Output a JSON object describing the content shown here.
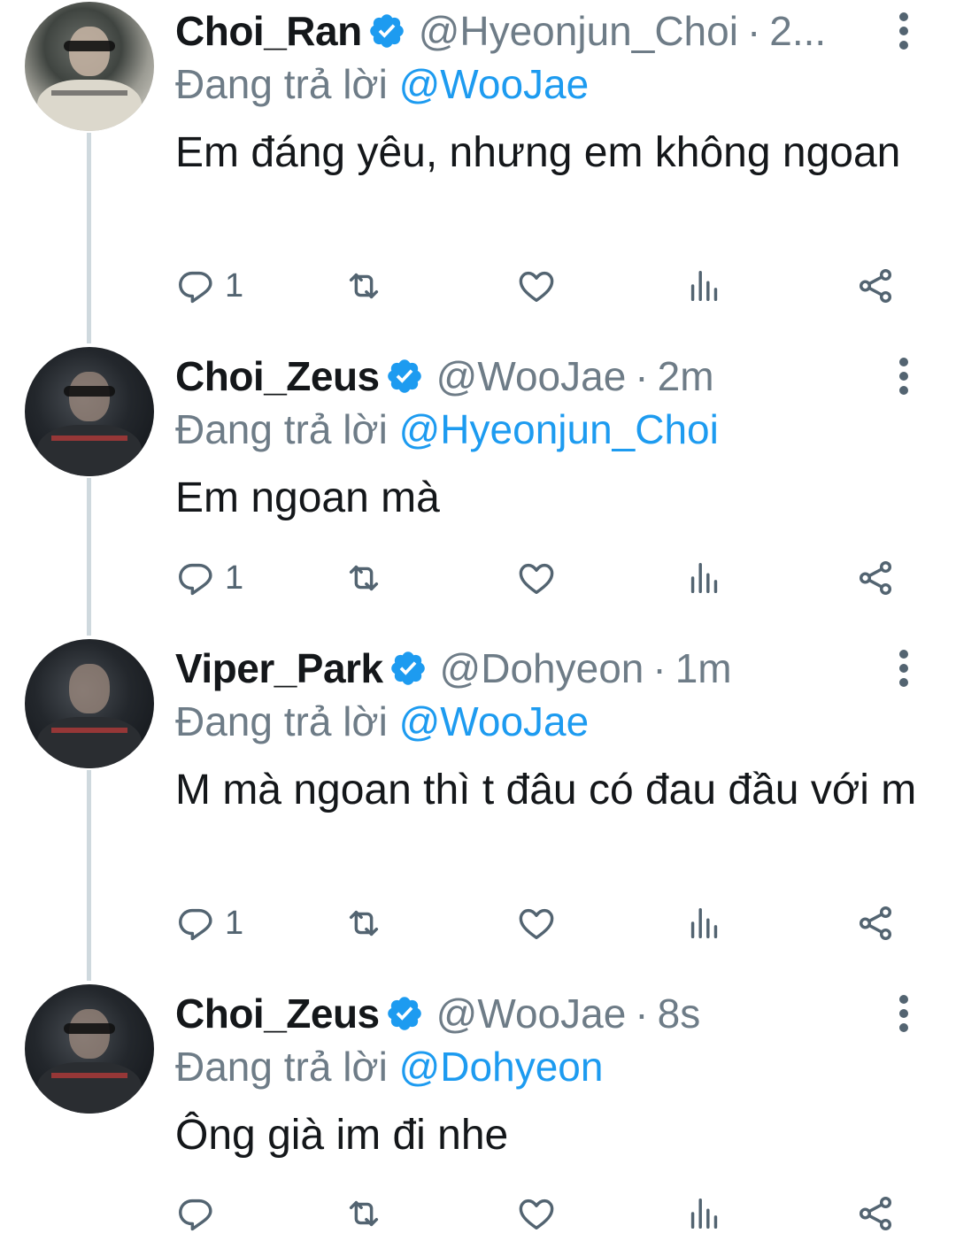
{
  "reply_prefix": "Đang trả lời",
  "tweets": [
    {
      "name": "Choi_Ran",
      "handle": "@Hyeonjun_Choi",
      "separator": "·",
      "time": "2...",
      "reply_to": "@WooJae",
      "text": "Em đáng yêu, nhưng em không ngoan",
      "reply_count": "1",
      "avatar_style": "light"
    },
    {
      "name": "Choi_Zeus",
      "handle": "@WooJae",
      "separator": "·",
      "time": "2m",
      "reply_to": "@Hyeonjun_Choi",
      "text": "Em ngoan mà",
      "reply_count": "1",
      "avatar_style": "dark"
    },
    {
      "name": "Viper_Park",
      "handle": "@Dohyeon",
      "separator": "·",
      "time": "1m",
      "reply_to": "@WooJae",
      "text": "M mà ngoan thì t đâu có đau đầu với m",
      "reply_count": "1",
      "avatar_style": "dark"
    },
    {
      "name": "Choi_Zeus",
      "handle": "@WooJae",
      "separator": "·",
      "time": "8s",
      "reply_to": "@Dohyeon",
      "text": "Ông già im đi nhe",
      "reply_count": "",
      "avatar_style": "dark"
    }
  ],
  "icons": {
    "verified": "verified-badge-icon",
    "more": "more-vertical-icon",
    "reply": "reply-icon",
    "retweet": "retweet-icon",
    "like": "heart-icon",
    "analytics": "analytics-icon",
    "share": "share-icon"
  },
  "colors": {
    "verified": "#1d9bf0",
    "mention": "#1d9bf0",
    "secondary_text": "#6e7c87",
    "icon": "#536471",
    "thread_line": "#cfd9de"
  }
}
